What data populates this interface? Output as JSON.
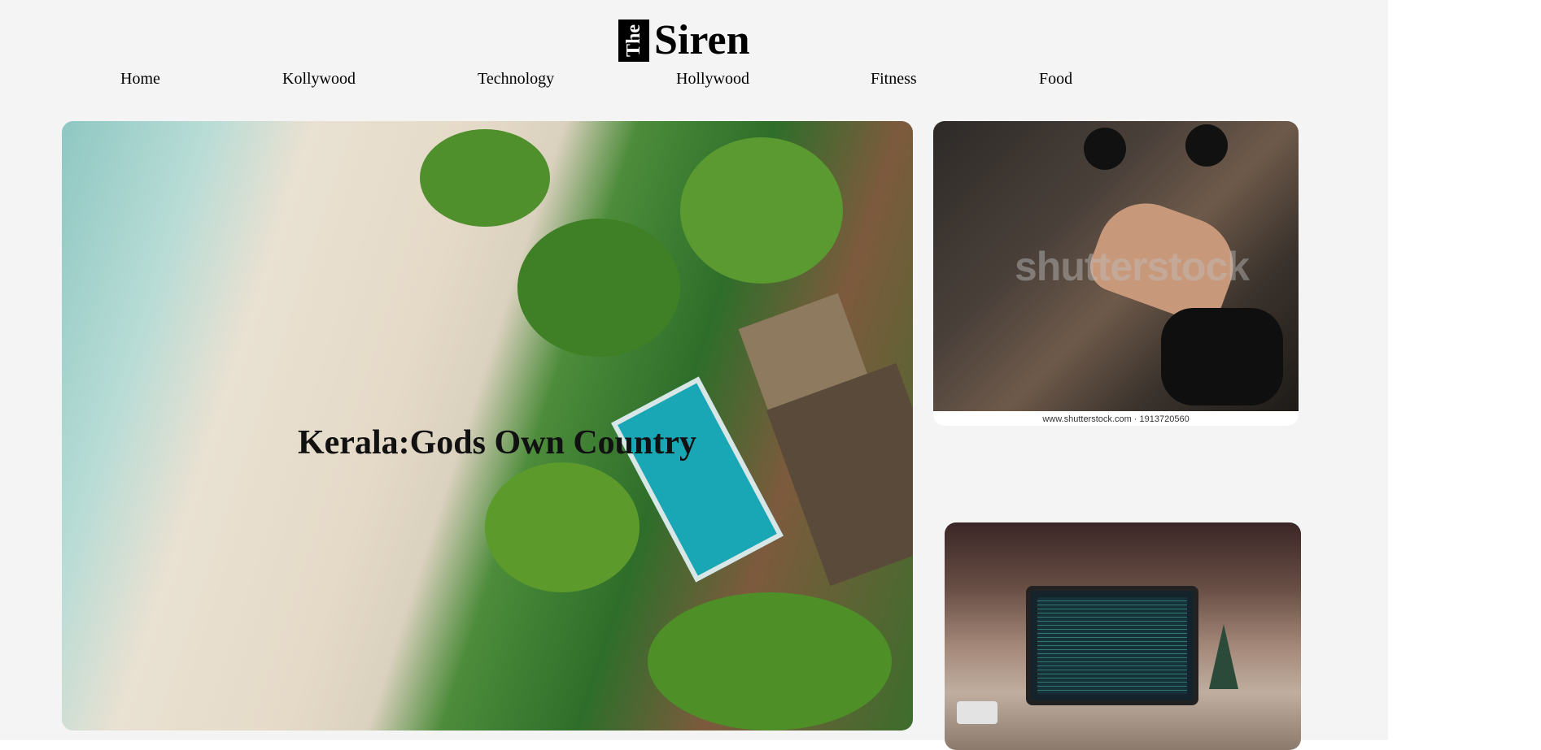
{
  "logo": {
    "prefix": "The",
    "name": "Siren"
  },
  "nav": {
    "items": [
      {
        "label": "Home"
      },
      {
        "label": "Kollywood"
      },
      {
        "label": "Technology"
      },
      {
        "label": "Hollywood"
      },
      {
        "label": "Fitness"
      },
      {
        "label": "Food"
      }
    ]
  },
  "hero": {
    "title": "Kerala:Gods Own Country"
  },
  "fitness_card": {
    "watermark": "shutterstock",
    "caption": "www.shutterstock.com · 1913720560"
  },
  "colors": {
    "page_background": "#f4f4f4",
    "text": "#000000"
  }
}
